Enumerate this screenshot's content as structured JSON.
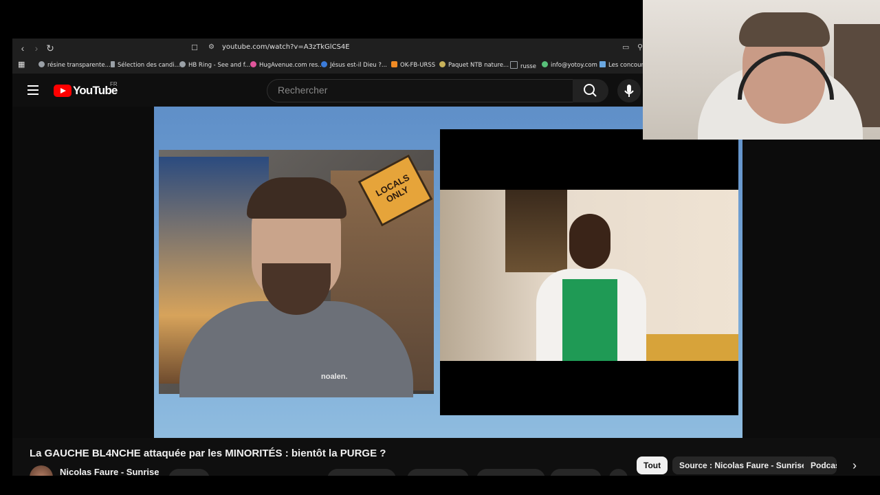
{
  "browser": {
    "url": "youtube.com/watch?v=A3zTkGlCS4E",
    "bookmarks": [
      {
        "label": "résine transparente...",
        "icon": "globe-icon",
        "color": "#9aa0a6"
      },
      {
        "label": "Sélection des candi...",
        "icon": "page-icon",
        "color": "#9aa0a6"
      },
      {
        "label": "HB Ring - See and f...",
        "icon": "globe-icon",
        "color": "#9aa0a6"
      },
      {
        "label": "HugAvenue.com res...",
        "icon": "heart-icon",
        "color": "#e0559b"
      },
      {
        "label": "Jésus est-il Dieu ?...",
        "icon": "circle-icon",
        "color": "#3b7bd9"
      },
      {
        "label": "OK-FB-URSS",
        "icon": "square-icon",
        "color": "#f08a24"
      },
      {
        "label": "Paquet NTB nature...",
        "icon": "plant-icon",
        "color": "#c8b25a"
      },
      {
        "label": "russe",
        "icon": "folder-icon",
        "color": "#9aa0a6"
      },
      {
        "label": "info@yotoy.com",
        "icon": "leaf-icon",
        "color": "#58c07a"
      },
      {
        "label": "Les concours",
        "icon": "list-icon",
        "color": "#6aa7e0"
      }
    ]
  },
  "youtube": {
    "logo_text": "YouTube",
    "country_code": "FR",
    "search_placeholder": "Rechercher"
  },
  "video": {
    "title": "La GAUCHE BL4NCHE attaquée par les MINORITÉS : bientôt la PURGE ?",
    "channel": "Nicolas Faure - Sunrise",
    "poster_sign": "LOCALS ONLY",
    "shirt_text": "noalen."
  },
  "chips": [
    {
      "label": "Tout",
      "active": true
    },
    {
      "label": "Source : Nicolas Faure - Sunrise",
      "active": false
    },
    {
      "label": "Podcas",
      "active": false
    }
  ],
  "colors": {
    "brand_red": "#ff0000",
    "background": "#0f0f0f"
  }
}
